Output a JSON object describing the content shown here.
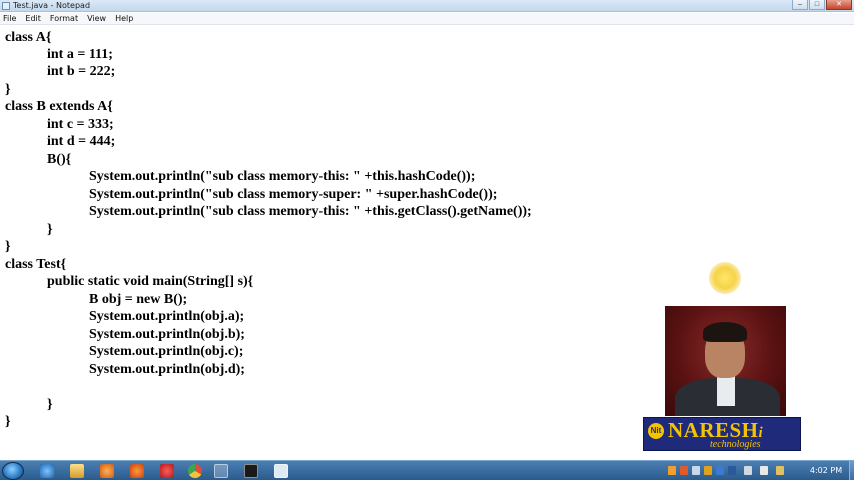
{
  "window": {
    "title": "Test.java - Notepad",
    "controls": {
      "minimize": "–",
      "maximize": "□",
      "close": "✕"
    }
  },
  "menubar": {
    "items": [
      "File",
      "Edit",
      "Format",
      "View",
      "Help"
    ]
  },
  "editor": {
    "lines": [
      "class A{",
      "            int a = 111;",
      "            int b = 222;",
      "}",
      "class B extends A{",
      "            int c = 333;",
      "            int d = 444;",
      "            B(){",
      "                        System.out.println(\"sub class memory-this: \" +this.hashCode());",
      "                        System.out.println(\"sub class memory-super: \" +super.hashCode());",
      "                        System.out.println(\"sub class memory-this: \" +this.getClass().getName());",
      "            }",
      "}",
      "class Test{",
      "            public static void main(String[] s){",
      "                        B obj = new B();",
      "                        System.out.println(obj.a);",
      "                        System.out.println(obj.b);",
      "                        System.out.println(obj.c);",
      "                        System.out.println(obj.d);",
      "",
      "            }",
      "}"
    ]
  },
  "brand": {
    "logo_mark": "Nit",
    "name": "NARESH",
    "name_suffix": "i",
    "tagline": "technologies",
    "colors": {
      "background": "#1f2b7a",
      "text": "#f5c400"
    }
  },
  "taskbar": {
    "clock": "4:02 PM",
    "pinned_icons": [
      "start-orb-icon",
      "ie-icon",
      "explorer-icon",
      "media-player-icon",
      "firefox-icon",
      "opera-icon",
      "chrome-icon",
      "window-icon",
      "cmd-icon",
      "notepad-icon"
    ],
    "tray_icons": [
      "tray-icon-1",
      "tray-icon-2",
      "tray-icon-3",
      "tray-icon-4",
      "tray-icon-5",
      "tray-icon-6",
      "network-icon",
      "volume-icon",
      "flag-icon"
    ]
  }
}
